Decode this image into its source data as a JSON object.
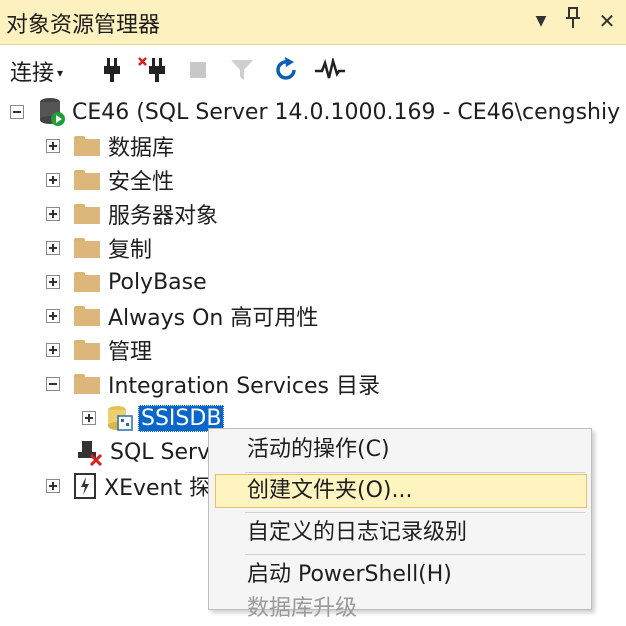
{
  "panel": {
    "title": "对象资源管理器"
  },
  "titlebar_buttons": {
    "dropdown": "▼",
    "pin": "📌",
    "close": "✕"
  },
  "toolbar": {
    "connect_label": "连接",
    "connect_arrow": "▾",
    "icons": [
      "connect-plug-icon",
      "disconnect-plug-icon",
      "stop-icon",
      "filter-icon",
      "refresh-icon",
      "activity-monitor-icon"
    ]
  },
  "tree": {
    "server": "CE46 (SQL Server 14.0.1000.169 - CE46\\cengshiy",
    "items": [
      {
        "label": "数据库"
      },
      {
        "label": "安全性"
      },
      {
        "label": "服务器对象"
      },
      {
        "label": "复制"
      },
      {
        "label": "PolyBase"
      },
      {
        "label": "Always On 高可用性"
      },
      {
        "label": "管理"
      },
      {
        "label": "Integration Services 目录"
      }
    ],
    "ssisdb": "SSISDB",
    "agent": "SQL Serv",
    "xevent": "XEvent 探"
  },
  "context_menu": {
    "items": [
      {
        "label": "活动的操作(C)"
      },
      {
        "label": "创建文件夹(O)..."
      },
      {
        "label": "自定义的日志记录级别"
      },
      {
        "label": "启动 PowerShell(H)"
      },
      {
        "label": "数据库升级"
      }
    ]
  },
  "colors": {
    "title_bg": "#fcf1bf",
    "selection": "#0a67c9",
    "highlight": "#fdf4bf"
  }
}
